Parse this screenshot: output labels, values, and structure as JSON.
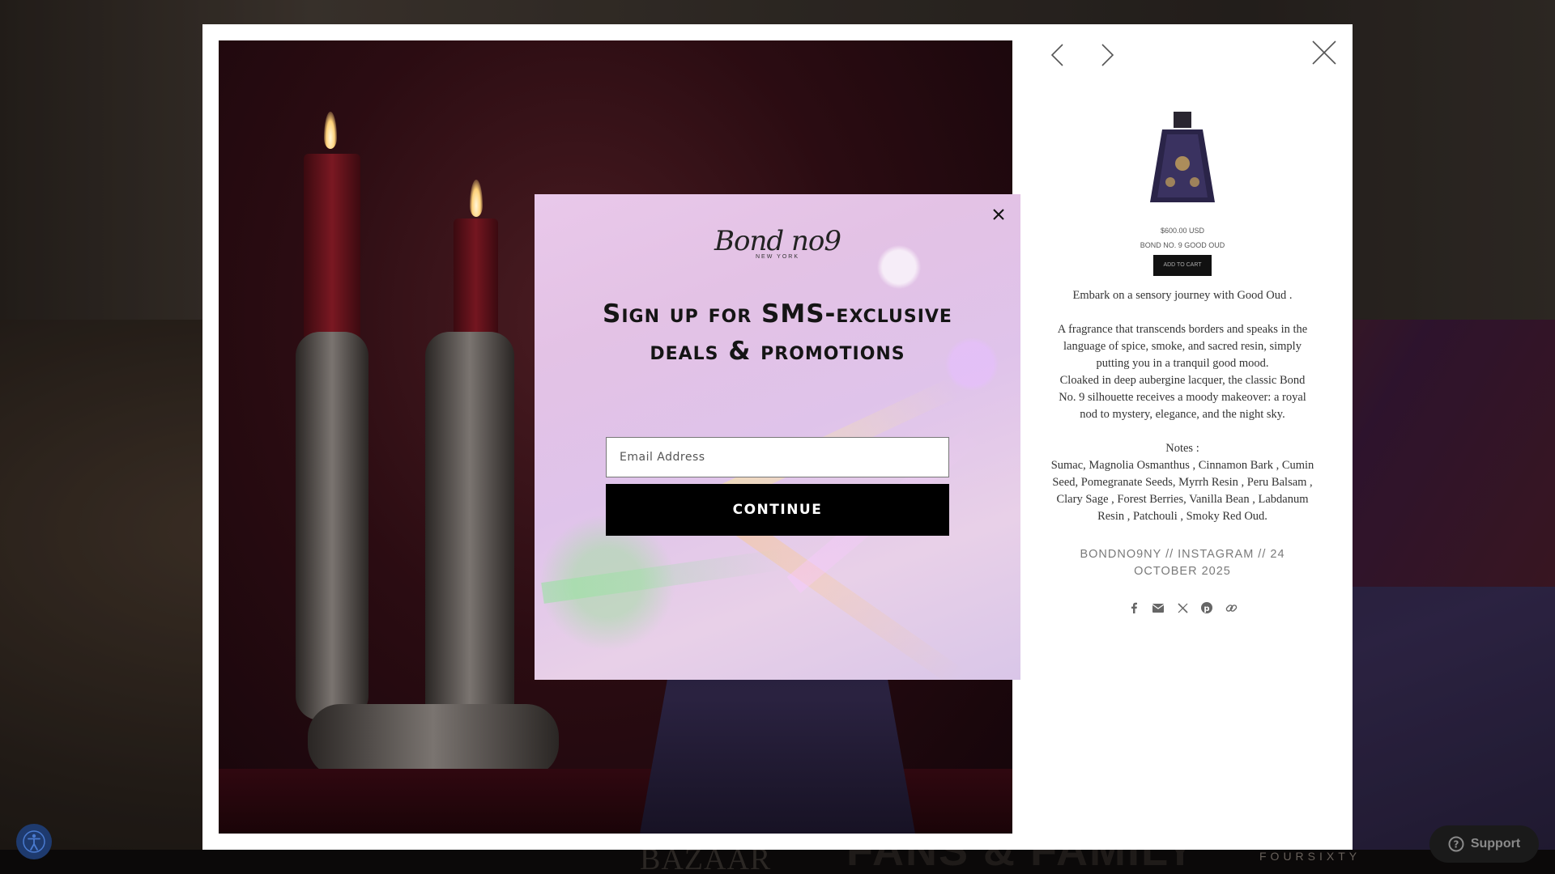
{
  "background": {
    "press_logo": "BAZAAR",
    "banner_text": "FANS & FAMILY",
    "widget_brand": "FOURSIXTY"
  },
  "lightbox": {
    "product": {
      "price": "$600.00 USD",
      "name": "BOND NO. 9 GOOD OUD",
      "add_to_cart": "ADD TO CART"
    },
    "caption": {
      "intro": "Embark on a sensory journey with Good Oud .",
      "paragraph1": "A fragrance that transcends borders and speaks in the language of spice, smoke, and sacred resin, simply putting you in a tranquil good mood.",
      "paragraph2": "Cloaked in deep aubergine lacquer, the classic Bond No. 9 silhouette receives a moody makeover: a royal nod to mystery, elegance, and the night sky.",
      "notes_label": "Notes :",
      "notes": "Sumac, Magnolia Osmanthus , Cinnamon Bark , Cumin Seed, Pomegranate Seeds, Myrrh Resin , Peru Balsam , Clary Sage , Forest Berries, Vanilla Bean , Labdanum Resin , Patchouli , Smoky Red Oud."
    },
    "source": "BONDNO9NY // INSTAGRAM // 24 OCTOBER 2025",
    "share_icons": [
      "facebook-icon",
      "email-icon",
      "x-icon",
      "pinterest-icon",
      "link-icon"
    ]
  },
  "modal": {
    "logo_script": "Bond no9",
    "logo_sub": "NEW YORK",
    "headline": "Sign up for SMS-exclusive deals & promotions",
    "email_placeholder": "Email Address",
    "continue_label": "CONTINUE"
  },
  "widgets": {
    "support_label": "Support"
  },
  "colors": {
    "modal_button": "#000000",
    "accessibility_button": "#1e3a6e",
    "lightbox_bg": "#ffffff"
  }
}
